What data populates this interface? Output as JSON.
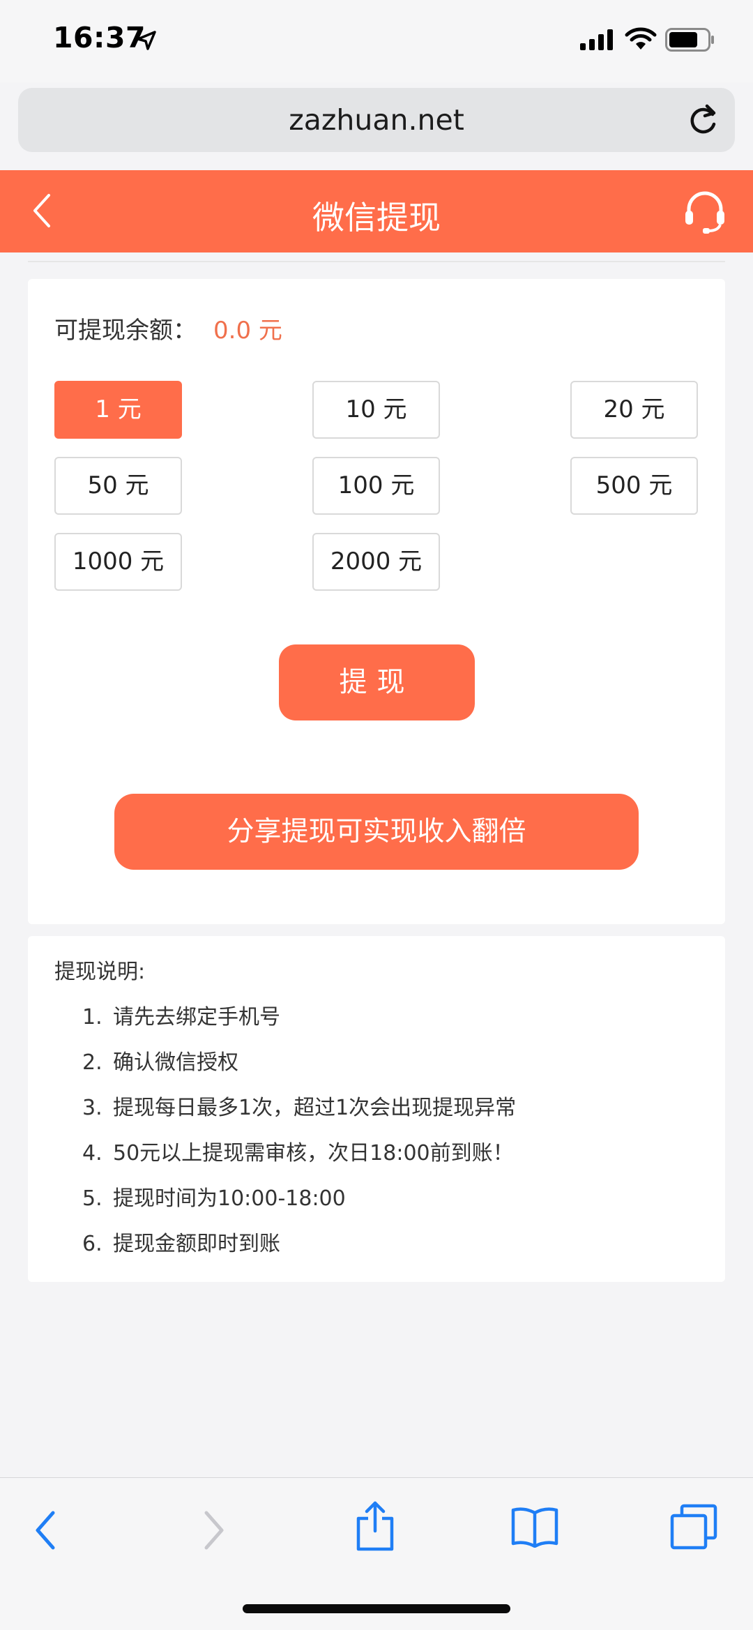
{
  "status_bar": {
    "time": "16:37",
    "icons": [
      "location-arrow-icon",
      "signal-icon",
      "wifi-icon",
      "battery-icon"
    ]
  },
  "browser": {
    "address": "zazhuan.net",
    "toolbar_icons": [
      "back-icon",
      "forward-icon",
      "share-icon",
      "bookmarks-icon",
      "tabs-icon"
    ]
  },
  "header": {
    "title": "微信提现",
    "left_icon": "chevron-left-icon",
    "right_icon": "headset-icon"
  },
  "withdraw": {
    "balance_label": "可提现余额：",
    "balance_value": "0.0 元",
    "amounts": [
      {
        "label": "1 元",
        "selected": true
      },
      {
        "label": "10 元",
        "selected": false
      },
      {
        "label": "20 元",
        "selected": false
      },
      {
        "label": "50 元",
        "selected": false
      },
      {
        "label": "100 元",
        "selected": false
      },
      {
        "label": "500 元",
        "selected": false
      },
      {
        "label": "1000 元",
        "selected": false
      },
      {
        "label": "2000 元",
        "selected": false
      }
    ],
    "withdraw_button": "提现",
    "share_button": "分享提现可实现收入翻倍"
  },
  "notes": {
    "title": "提现说明:",
    "items": [
      {
        "num": "1.",
        "text": "请先去绑定手机号"
      },
      {
        "num": "2.",
        "text": "确认微信授权"
      },
      {
        "num": "3.",
        "text": "提现每日最多1次，超过1次会出现提现异常"
      },
      {
        "num": "4.",
        "text": "50元以上提现需审核，次日18:00前到账！"
      },
      {
        "num": "5.",
        "text": "提现时间为10:00-18:00"
      },
      {
        "num": "6.",
        "text": "提现金额即时到账"
      }
    ]
  },
  "colors": {
    "accent": "#ff6d4a",
    "balance": "#f0704c",
    "ios_blue": "#1f7ef5"
  }
}
